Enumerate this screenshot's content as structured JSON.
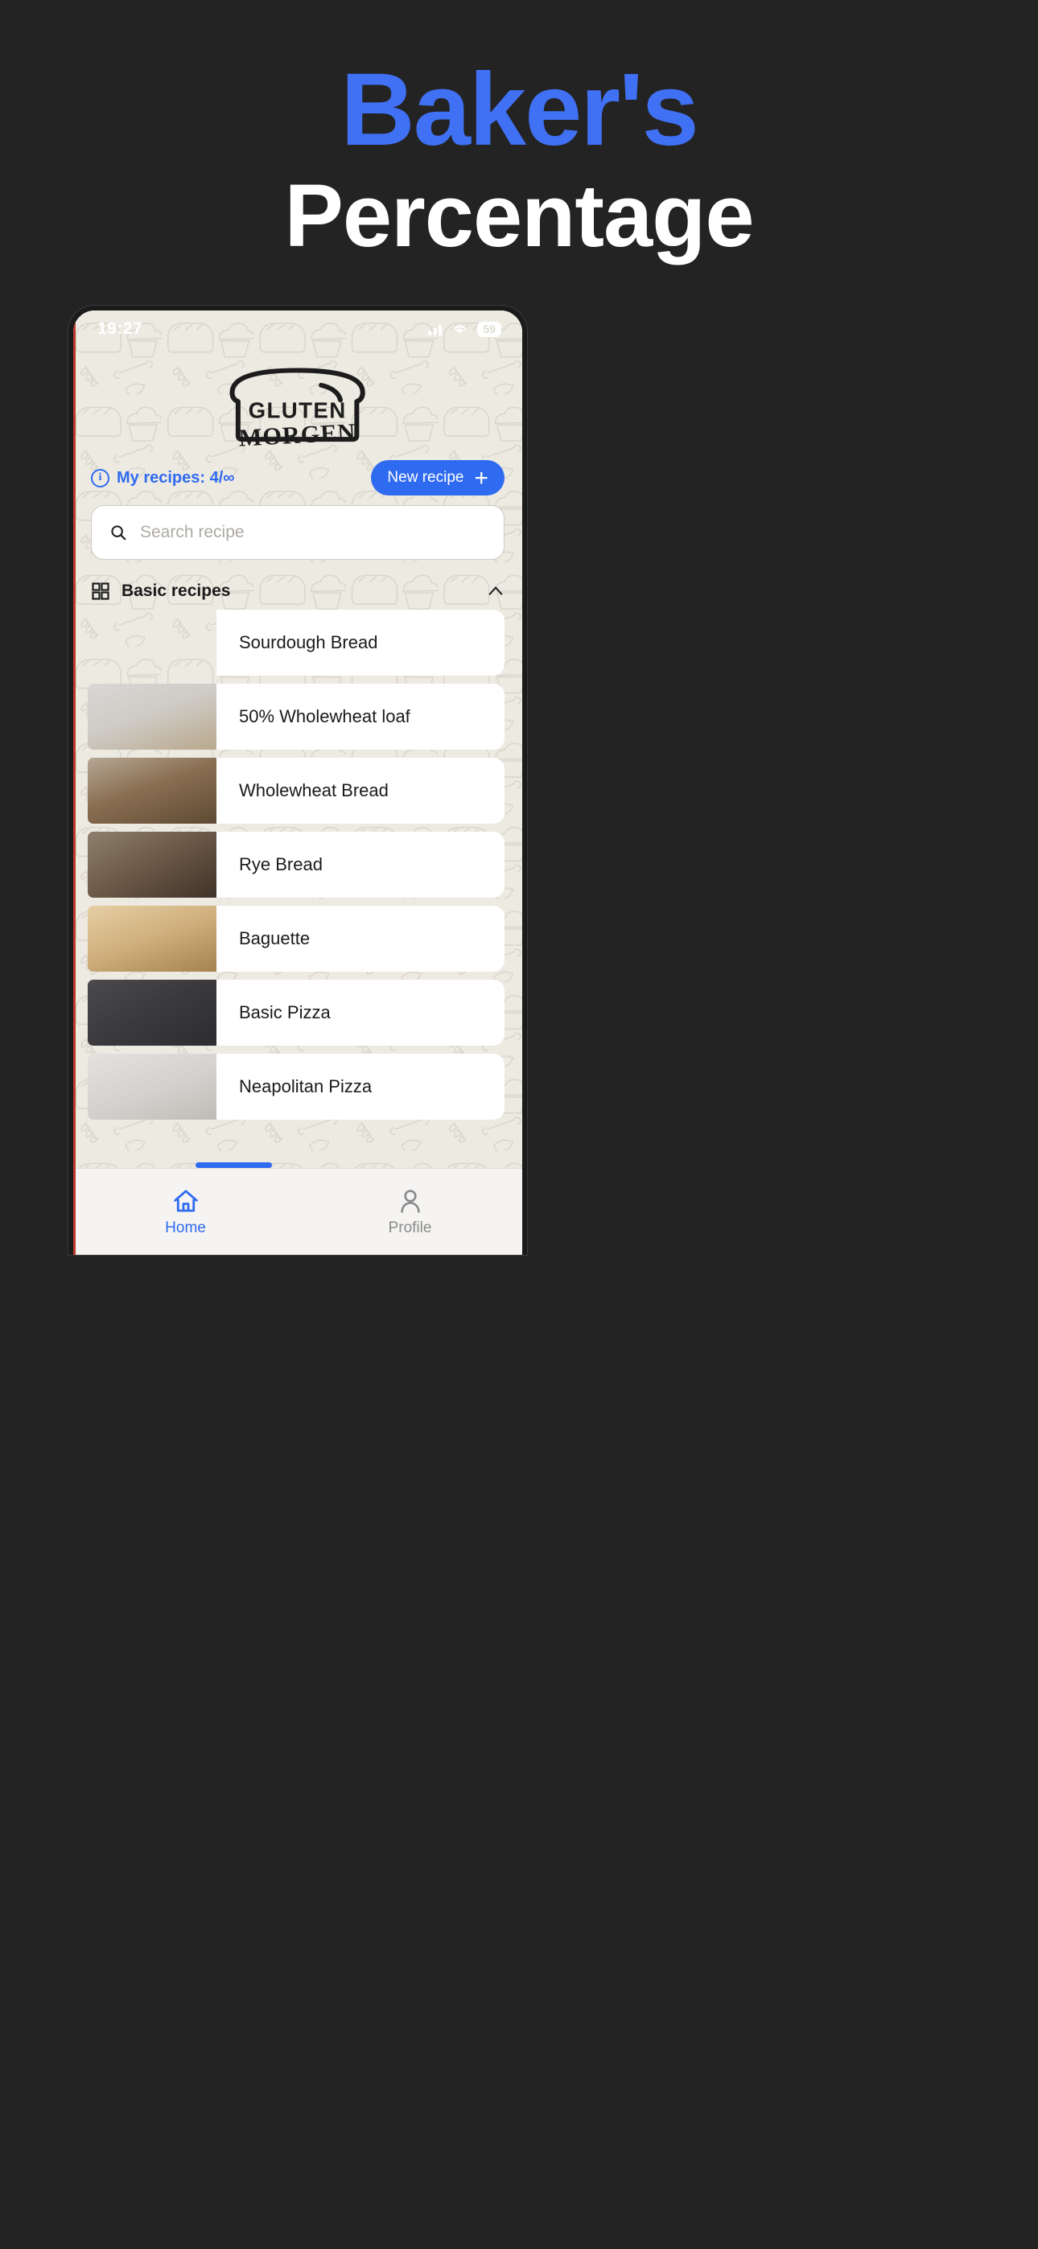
{
  "headline": {
    "line1": "Baker's",
    "line2": "Percentage",
    "line1_color": "#4070f4",
    "line2_color": "#ffffff",
    "background_color": "#232323"
  },
  "phone": {
    "status_bar": {
      "time": "19:27",
      "battery_level": "59",
      "icons": [
        "signal-icon",
        "wifi-icon",
        "battery-icon"
      ]
    },
    "logo": {
      "line1": "GLUTEN",
      "line2": "MORGEN",
      "shape": "bread-loaf-outline"
    },
    "recipes_meta": {
      "info_icon": "info-icon",
      "label": "My recipes: 4/∞",
      "accent_color": "#2f6bf0"
    },
    "new_recipe_button": {
      "label": "New recipe",
      "icon": "plus-icon",
      "background_color": "#2f6bf0",
      "text_color": "#ffffff"
    },
    "search": {
      "placeholder": "Search recipe",
      "value": "",
      "icon": "search-icon"
    },
    "section": {
      "icon": "grid-icon",
      "title": "Basic recipes",
      "collapse_icon": "chevron-up-icon",
      "expanded": true
    },
    "recipes": [
      {
        "name": "Sourdough Bread",
        "thumb_class": "t-sourdough",
        "thumb_alt": "sourdough-loaf-in-dutch-oven"
      },
      {
        "name": "50% Wholewheat loaf",
        "thumb_class": "t-50whole",
        "thumb_alt": "sliced-wholewheat-loaf-on-board"
      },
      {
        "name": "Wholewheat Bread",
        "thumb_class": "t-whole",
        "thumb_alt": "dark-wholewheat-loaf-halves"
      },
      {
        "name": "Rye Bread",
        "thumb_class": "t-rye",
        "thumb_alt": "rye-bread-slices-rustic"
      },
      {
        "name": "Baguette",
        "thumb_class": "t-baguette",
        "thumb_alt": "row-of-baguettes"
      },
      {
        "name": "Basic Pizza",
        "thumb_class": "t-pizza",
        "thumb_alt": "margherita-pizza-on-peel"
      },
      {
        "name": "Neapolitan Pizza",
        "thumb_class": "t-neapolitan",
        "thumb_alt": "neapolitan-pizza-on-rack"
      }
    ],
    "bottom_nav": [
      {
        "label": "Home",
        "icon": "home-icon",
        "active": true
      },
      {
        "label": "Profile",
        "icon": "person-icon",
        "active": false
      }
    ]
  }
}
